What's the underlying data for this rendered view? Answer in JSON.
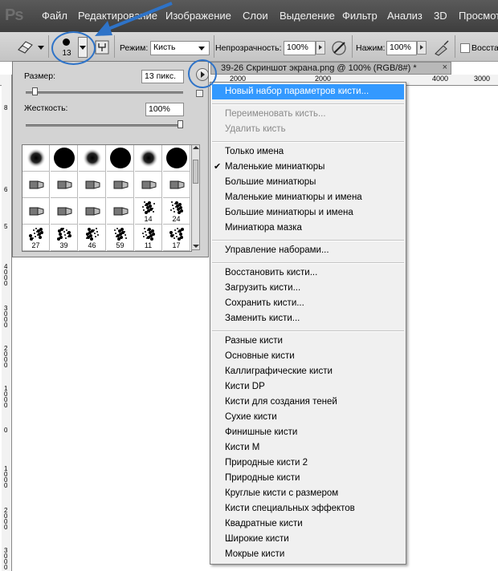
{
  "app": {
    "logo": "Ps"
  },
  "menubar": {
    "items": [
      "Файл",
      "Редактирование",
      "Изображение",
      "Слои",
      "Выделение",
      "Фильтр",
      "Анализ",
      "3D",
      "Просмот"
    ]
  },
  "options_bar": {
    "brush_size_value": "13",
    "mode_label": "Режим:",
    "mode_value": "Кисть",
    "opacity_label": "Непрозрачность:",
    "opacity_value": "100%",
    "pressure_label": "Нажим:",
    "pressure_value": "100%",
    "restore_label": "Восста"
  },
  "document": {
    "tab_title": "39-26 Скриншот экрана.png @ 100% (RGB/8#) *",
    "close_glyph": "×",
    "ruler_top": [
      "2000",
      "2000",
      "4000",
      "3000"
    ],
    "ruler_left": [
      "8",
      "6",
      "5",
      "4000",
      "3000",
      "2000",
      "1000",
      "0",
      "1000",
      "2000",
      "3000"
    ]
  },
  "brush_panel": {
    "size_label": "Размер:",
    "size_value": "13 пикс.",
    "hardness_label": "Жесткость:",
    "hardness_value": "100%",
    "size_fraction": 0.04,
    "hardness_fraction": 1.0,
    "brushes": [
      {
        "kind": "soft",
        "label": ""
      },
      {
        "kind": "hard",
        "label": ""
      },
      {
        "kind": "soft",
        "label": ""
      },
      {
        "kind": "hard",
        "label": ""
      },
      {
        "kind": "soft",
        "label": ""
      },
      {
        "kind": "hard",
        "label": ""
      },
      {
        "kind": "tip",
        "label": ""
      },
      {
        "kind": "tip",
        "label": ""
      },
      {
        "kind": "tip",
        "label": ""
      },
      {
        "kind": "tip",
        "label": ""
      },
      {
        "kind": "tip",
        "label": ""
      },
      {
        "kind": "tip",
        "label": ""
      },
      {
        "kind": "tip",
        "label": ""
      },
      {
        "kind": "tip",
        "label": ""
      },
      {
        "kind": "tip",
        "label": ""
      },
      {
        "kind": "tip",
        "label": ""
      },
      {
        "kind": "splat",
        "label": "14"
      },
      {
        "kind": "splat",
        "label": "24"
      },
      {
        "kind": "splat",
        "label": "27"
      },
      {
        "kind": "splat",
        "label": "39"
      },
      {
        "kind": "splat",
        "label": "46"
      },
      {
        "kind": "splat",
        "label": "59"
      },
      {
        "kind": "splat",
        "label": "11"
      },
      {
        "kind": "splat",
        "label": "17"
      }
    ]
  },
  "dropdown": {
    "check_glyph": "✔",
    "items": [
      {
        "label": "Новый набор параметров кисти...",
        "state": "highlighted"
      },
      {
        "separator": true
      },
      {
        "label": "Переименовать кисть...",
        "state": "disabled"
      },
      {
        "label": "Удалить кисть",
        "state": "disabled"
      },
      {
        "separator": true
      },
      {
        "label": "Только имена",
        "state": "normal"
      },
      {
        "label": "Маленькие миниатюры",
        "state": "checked"
      },
      {
        "label": "Большие миниатюры",
        "state": "normal"
      },
      {
        "label": "Маленькие миниатюры и имена",
        "state": "normal"
      },
      {
        "label": "Большие миниатюры и имена",
        "state": "normal"
      },
      {
        "label": "Миниатюра мазка",
        "state": "normal"
      },
      {
        "separator": true
      },
      {
        "label": "Управление наборами...",
        "state": "normal"
      },
      {
        "separator": true
      },
      {
        "label": "Восстановить кисти...",
        "state": "normal"
      },
      {
        "label": "Загрузить кисти...",
        "state": "normal"
      },
      {
        "label": "Сохранить кисти...",
        "state": "normal"
      },
      {
        "label": "Заменить кисти...",
        "state": "normal"
      },
      {
        "separator": true
      },
      {
        "label": "Разные кисти",
        "state": "normal"
      },
      {
        "label": "Основные кисти",
        "state": "normal"
      },
      {
        "label": "Каллиграфические кисти",
        "state": "normal"
      },
      {
        "label": "Кисти DP",
        "state": "normal"
      },
      {
        "label": "Кисти для создания теней",
        "state": "normal"
      },
      {
        "label": "Сухие кисти",
        "state": "normal"
      },
      {
        "label": "Финишные кисти",
        "state": "normal"
      },
      {
        "label": "Кисти M",
        "state": "normal"
      },
      {
        "label": "Природные кисти 2",
        "state": "normal"
      },
      {
        "label": "Природные кисти",
        "state": "normal"
      },
      {
        "label": "Круглые кисти с размером",
        "state": "normal"
      },
      {
        "label": "Кисти специальных эффектов",
        "state": "normal"
      },
      {
        "label": "Квадратные кисти",
        "state": "normal"
      },
      {
        "label": "Широкие кисти",
        "state": "normal"
      },
      {
        "label": "Мокрые кисти",
        "state": "normal"
      }
    ]
  },
  "colors": {
    "highlight": "#3399ff",
    "annotation": "#2e73c8"
  }
}
